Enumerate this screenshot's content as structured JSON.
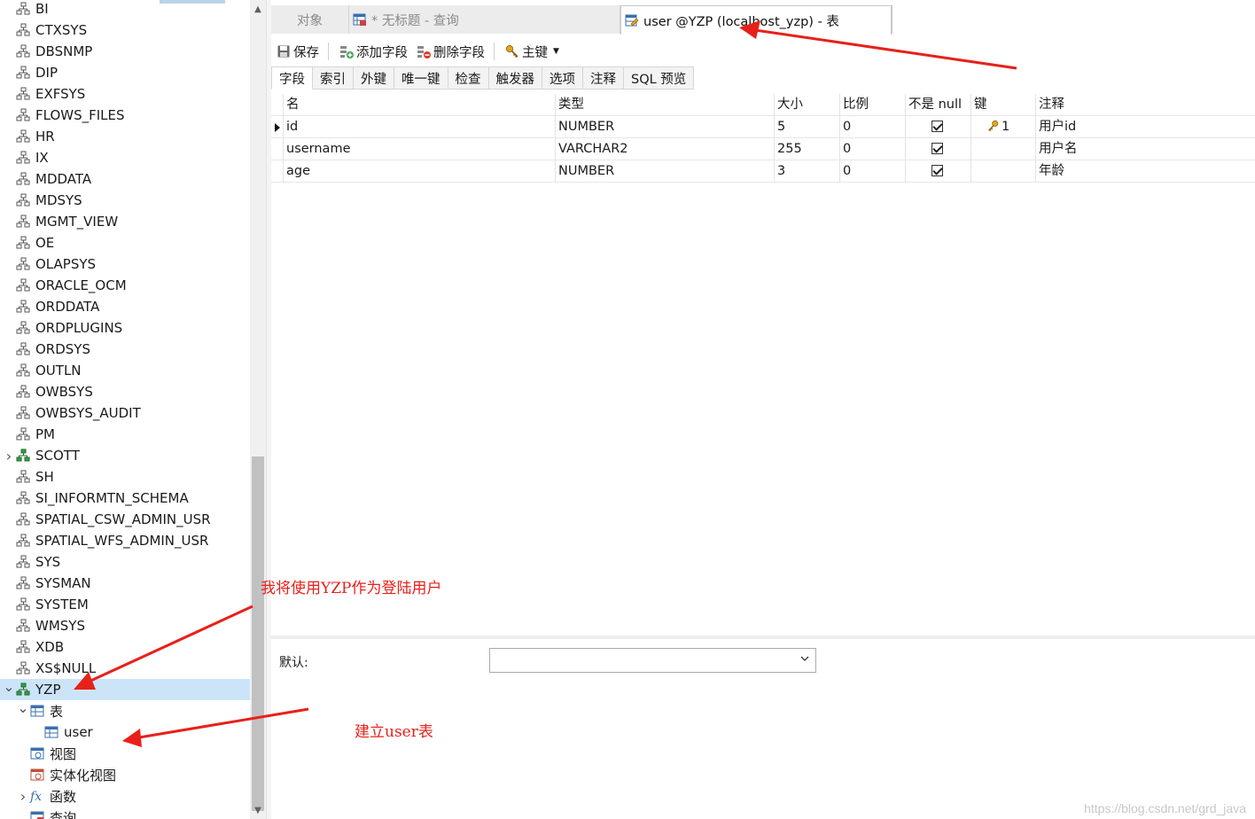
{
  "tree": {
    "items": [
      {
        "label": "BI",
        "twisty": "",
        "kind": "schema"
      },
      {
        "label": "CTXSYS",
        "twisty": "",
        "kind": "schema"
      },
      {
        "label": "DBSNMP",
        "twisty": "",
        "kind": "schema"
      },
      {
        "label": "DIP",
        "twisty": "",
        "kind": "schema"
      },
      {
        "label": "EXFSYS",
        "twisty": "",
        "kind": "schema"
      },
      {
        "label": "FLOWS_FILES",
        "twisty": "",
        "kind": "schema"
      },
      {
        "label": "HR",
        "twisty": "",
        "kind": "schema"
      },
      {
        "label": "IX",
        "twisty": "",
        "kind": "schema"
      },
      {
        "label": "MDDATA",
        "twisty": "",
        "kind": "schema"
      },
      {
        "label": "MDSYS",
        "twisty": "",
        "kind": "schema"
      },
      {
        "label": "MGMT_VIEW",
        "twisty": "",
        "kind": "schema"
      },
      {
        "label": "OE",
        "twisty": "",
        "kind": "schema"
      },
      {
        "label": "OLAPSYS",
        "twisty": "",
        "kind": "schema"
      },
      {
        "label": "ORACLE_OCM",
        "twisty": "",
        "kind": "schema"
      },
      {
        "label": "ORDDATA",
        "twisty": "",
        "kind": "schema"
      },
      {
        "label": "ORDPLUGINS",
        "twisty": "",
        "kind": "schema"
      },
      {
        "label": "ORDSYS",
        "twisty": "",
        "kind": "schema"
      },
      {
        "label": "OUTLN",
        "twisty": "",
        "kind": "schema"
      },
      {
        "label": "OWBSYS",
        "twisty": "",
        "kind": "schema"
      },
      {
        "label": "OWBSYS_AUDIT",
        "twisty": "",
        "kind": "schema"
      },
      {
        "label": "PM",
        "twisty": "",
        "kind": "schema"
      },
      {
        "label": "SCOTT",
        "twisty": ">",
        "kind": "schema-open"
      },
      {
        "label": "SH",
        "twisty": "",
        "kind": "schema"
      },
      {
        "label": "SI_INFORMTN_SCHEMA",
        "twisty": "",
        "kind": "schema"
      },
      {
        "label": "SPATIAL_CSW_ADMIN_USR",
        "twisty": "",
        "kind": "schema"
      },
      {
        "label": "SPATIAL_WFS_ADMIN_USR",
        "twisty": "",
        "kind": "schema"
      },
      {
        "label": "SYS",
        "twisty": "",
        "kind": "schema"
      },
      {
        "label": "SYSMAN",
        "twisty": "",
        "kind": "schema"
      },
      {
        "label": "SYSTEM",
        "twisty": "",
        "kind": "schema"
      },
      {
        "label": "WMSYS",
        "twisty": "",
        "kind": "schema"
      },
      {
        "label": "XDB",
        "twisty": "",
        "kind": "schema"
      },
      {
        "label": "XS$NULL",
        "twisty": "",
        "kind": "schema"
      },
      {
        "label": "YZP",
        "twisty": "v",
        "kind": "schema-open",
        "selected": true
      },
      {
        "label": "表",
        "twisty": "v",
        "kind": "table-group",
        "indent": 1
      },
      {
        "label": "user",
        "twisty": "",
        "kind": "table",
        "indent": 2
      },
      {
        "label": "视图",
        "twisty": "",
        "kind": "view",
        "indent": 1
      },
      {
        "label": "实体化视图",
        "twisty": "",
        "kind": "mview",
        "indent": 1
      },
      {
        "label": "函数",
        "twisty": ">",
        "kind": "function",
        "indent": 1
      },
      {
        "label": "查询",
        "twisty": "",
        "kind": "query",
        "indent": 1
      }
    ]
  },
  "tabs": {
    "objects": "对象",
    "query": "* 无标题 - 查询",
    "active": "user @YZP (localhost_yzp) - 表"
  },
  "toolbar": {
    "save": "保存",
    "add_field": "添加字段",
    "delete_field": "删除字段",
    "primary_key": "主键"
  },
  "subtabs": [
    "字段",
    "索引",
    "外键",
    "唯一键",
    "检查",
    "触发器",
    "选项",
    "注释",
    "SQL 预览"
  ],
  "grid": {
    "headers": [
      "名",
      "类型",
      "大小",
      "比例",
      "不是 null",
      "键",
      "注释"
    ],
    "rows": [
      {
        "name": "id",
        "type": "NUMBER",
        "size": "5",
        "scale": "0",
        "not_null": true,
        "key": "1",
        "comment": "用户id",
        "current": true
      },
      {
        "name": "username",
        "type": "VARCHAR2",
        "size": "255",
        "scale": "0",
        "not_null": true,
        "key": "",
        "comment": "用户名",
        "current": false
      },
      {
        "name": "age",
        "type": "NUMBER",
        "size": "3",
        "scale": "0",
        "not_null": true,
        "key": "",
        "comment": "年龄",
        "current": false
      }
    ]
  },
  "default_label": "默认:",
  "annotations": {
    "login_note": "我将使用YZP作为登陆用户",
    "table_note": "建立user表"
  },
  "watermark": "https://blog.csdn.net/grd_java",
  "colors": {
    "annotation": "#e8201a",
    "selected_row": "#cce4f7",
    "schema_icon_open": "#2e9a3e"
  }
}
